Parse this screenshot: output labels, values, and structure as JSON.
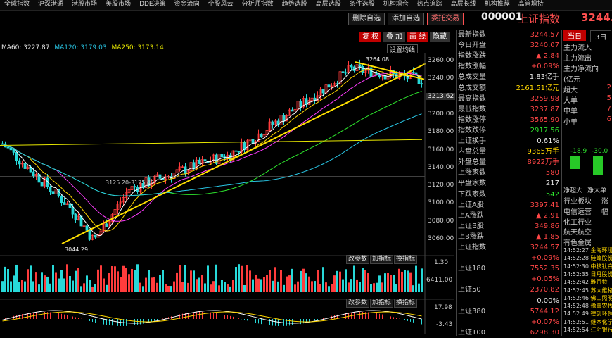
{
  "menu": [
    "全球指数",
    "沪深港通",
    "港股市场",
    "美股市场",
    "DDE决策",
    "资金流向",
    "个股风云",
    "分析师指数",
    "趋势选股",
    "高层选股",
    "条件选股",
    "机构增仓",
    "热点追踪",
    "高层长线",
    "机构推荐",
    "高管增持"
  ],
  "toolbar": {
    "delete_label": "删除自选",
    "add_label": "添加自选",
    "trade_label": "委托交易"
  },
  "header": {
    "code": "000001",
    "name": "上证指数",
    "price": "3244."
  },
  "chart_buttons": {
    "restore": "复 权",
    "overlay": "叠 加",
    "draw": "画 线",
    "hide": "隐藏"
  },
  "settings_label": "设置均线",
  "ma_legend": {
    "ma60": "MA60: 3227.87",
    "ma120": "MA120: 3179.03",
    "ma250": "MA250: 3173.14"
  },
  "price_axis": [
    "3260.00",
    "3240.00",
    "3220.00",
    "3200.00",
    "3180.00",
    "3160.00",
    "3140.00",
    "3120.00",
    "3100.00",
    "3080.00",
    "3060.00"
  ],
  "cursor_price": "3213.62",
  "annotations": {
    "high": "3264.08",
    "low": "3044.29",
    "mid": "3125.20-3125.42"
  },
  "sub_buttons": {
    "params": "改参数",
    "add_indicator": "加指标",
    "switch_indicator": "换指标"
  },
  "vol_axis": [
    "1.30",
    "6411.00"
  ],
  "macd_axis": [
    "17.98",
    "-3.43"
  ],
  "chart_data": {
    "type": "candlestick",
    "high": 3264.08,
    "low": 3044.29,
    "ylim": [
      3044,
      3270
    ]
  },
  "quote": [
    {
      "label": "最新指数",
      "value": "3244.57",
      "color": "red"
    },
    {
      "label": "今日开盘",
      "value": "3240.07",
      "color": "red"
    },
    {
      "label": "指数涨跌",
      "value": "▲ 2.84",
      "color": "red"
    },
    {
      "label": "指数涨幅",
      "value": "+0.09%",
      "color": "red"
    },
    {
      "label": "总成交量",
      "value": "1.83亿手",
      "color": "white"
    },
    {
      "label": "总成交额",
      "value": "2161.51亿元",
      "color": "yellow"
    },
    {
      "label": "最高指数",
      "value": "3259.98",
      "color": "red"
    },
    {
      "label": "最低指数",
      "value": "3237.87",
      "color": "red"
    },
    {
      "label": "指数涨停",
      "value": "3565.90",
      "color": "red"
    },
    {
      "label": "指数跌停",
      "value": "2917.56",
      "color": "green"
    },
    {
      "label": "上证换手",
      "value": "0.61%",
      "color": "white"
    },
    {
      "label": "内盘总量",
      "value": "9365万手",
      "color": "yellow"
    },
    {
      "label": "外盘总量",
      "value": "8922万手",
      "color": "red"
    },
    {
      "label": "上涨家数",
      "value": "580",
      "color": "red"
    },
    {
      "label": "平盘家数",
      "value": "217",
      "color": "white"
    },
    {
      "label": "下跌家数",
      "value": "542",
      "color": "green"
    },
    {
      "label": "上证A股",
      "value": "3397.41",
      "color": "red"
    },
    {
      "label": "上A涨跌",
      "value": "▲ 2.91",
      "color": "red"
    },
    {
      "label": "上证B股",
      "value": "349.86",
      "color": "red"
    },
    {
      "label": "上B涨跌",
      "value": "▲ 1.85",
      "color": "red"
    },
    {
      "label": "上证指数",
      "value": "3244.57",
      "color": "red"
    },
    {
      "label": "",
      "value": "+0.09%",
      "color": "red"
    },
    {
      "label": "上证180",
      "value": "7552.35",
      "color": "red"
    },
    {
      "label": "",
      "value": "+0.05%",
      "color": "red"
    },
    {
      "label": "上证50",
      "value": "2370.82",
      "color": "red"
    },
    {
      "label": "",
      "value": "0.00%",
      "color": "white"
    },
    {
      "label": "上证380",
      "value": "5744.12",
      "color": "red"
    },
    {
      "label": "",
      "value": "+0.07%",
      "color": "red"
    },
    {
      "label": "上证100",
      "value": "6298.30",
      "color": "red"
    }
  ],
  "right_tabs": {
    "today": "当日",
    "three": "3日"
  },
  "fund_flow": {
    "in": "主力流入",
    "out": "主力流出",
    "net": "主力净流向",
    "unit": "(亿元",
    "rows": [
      "超大",
      "大单",
      "中单",
      "小单"
    ],
    "vals": [
      "2",
      "5",
      "7",
      "6"
    ]
  },
  "bars": {
    "v1": "-18.9",
    "v2": "-30.0",
    "l1": "净超大",
    "l2": "净大单"
  },
  "industry": {
    "header": "行业板块",
    "header2": "涨幅",
    "items": [
      "电信运营",
      "化工行业",
      "航天航空",
      "有色金属"
    ]
  },
  "ticks": [
    {
      "time": "14:52:27",
      "name": "金海环境"
    },
    {
      "time": "14:52:28",
      "name": "硅峰股份"
    },
    {
      "time": "14:52:30",
      "name": "中核钛白"
    },
    {
      "time": "14:52:35",
      "name": "日月股份"
    },
    {
      "time": "14:52:42",
      "name": "雅百特"
    },
    {
      "time": "14:52:45",
      "name": "苏大维格"
    },
    {
      "time": "14:52:46",
      "name": "佛山照明"
    },
    {
      "time": "14:52:48",
      "name": "豫薰农牧"
    },
    {
      "time": "14:52:49",
      "name": "德创环保"
    },
    {
      "time": "14:52:51",
      "name": "继本化学"
    },
    {
      "time": "14:52:54",
      "name": "江阴银行"
    }
  ]
}
